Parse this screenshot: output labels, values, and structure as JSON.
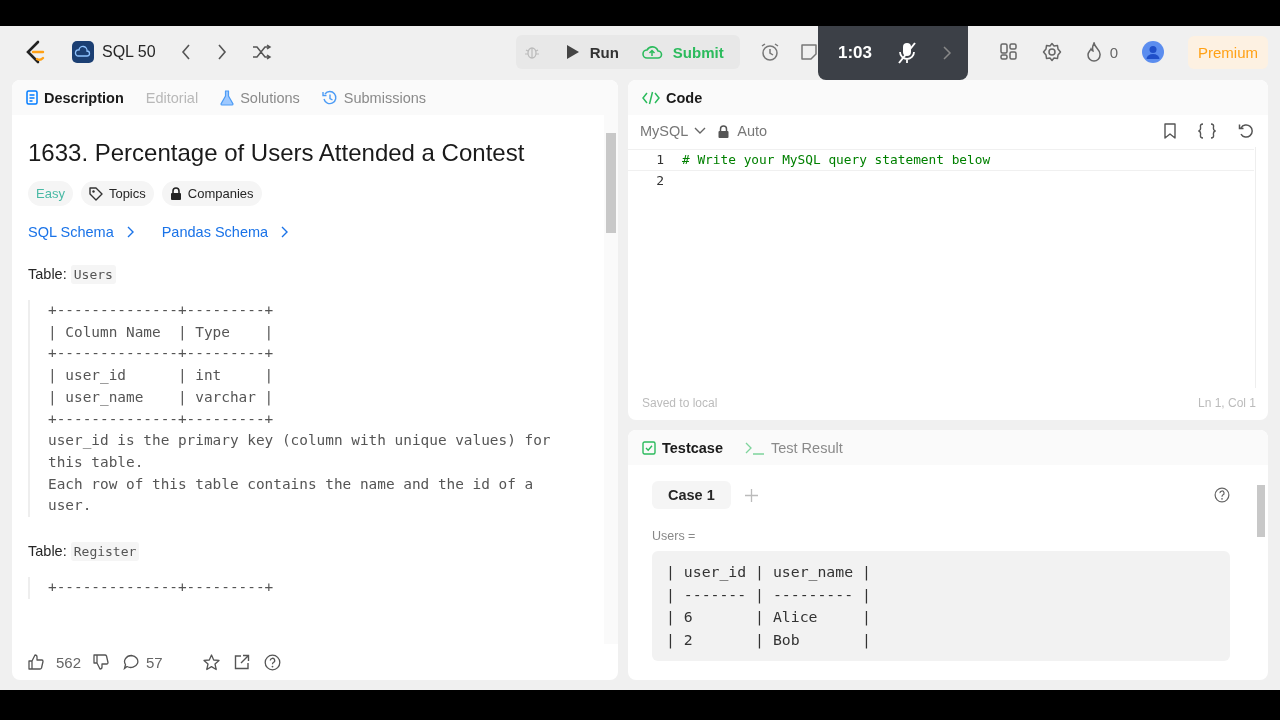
{
  "header": {
    "problem_list": "SQL 50",
    "run": "Run",
    "submit": "Submit",
    "timer": "1:03",
    "streak": "0",
    "premium": "Premium"
  },
  "description_panel": {
    "tabs": [
      {
        "label": "Description",
        "selected": true,
        "disabled": false
      },
      {
        "label": "Editorial",
        "selected": false,
        "disabled": true
      },
      {
        "label": "Solutions",
        "selected": false,
        "disabled": false
      },
      {
        "label": "Submissions",
        "selected": false,
        "disabled": false
      }
    ],
    "title": "1633. Percentage of Users Attended a Contest",
    "difficulty": "Easy",
    "tags": [
      {
        "label": "Topics"
      },
      {
        "label": "Companies"
      }
    ],
    "schema_links": [
      "SQL Schema",
      "Pandas Schema"
    ],
    "blocks": [
      {
        "kind": "table_label",
        "label": "Table:",
        "name": "Users"
      },
      {
        "kind": "code",
        "lines": [
          "+--------------+---------+",
          "| Column Name  | Type    |",
          "+--------------+---------+",
          "| user_id      | int     |",
          "| user_name    | varchar |",
          "+--------------+---------+",
          "user_id is the primary key (column with unique values) for",
          "this table.",
          "Each row of this table contains the name and the id of a",
          "user."
        ]
      },
      {
        "kind": "table_label",
        "label": "Table:",
        "name": "Register"
      },
      {
        "kind": "code",
        "lines": [
          "+--------------+---------+"
        ]
      }
    ],
    "likes": "562",
    "comments": "57"
  },
  "code_panel": {
    "tab": "Code",
    "language": "MySQL",
    "mode": "Auto",
    "lines": [
      {
        "number": "1",
        "text": "# Write your MySQL query statement below"
      },
      {
        "number": "2"
      }
    ],
    "status": "Saved to local",
    "cursor": "Ln 1, Col 1"
  },
  "test_panel": {
    "tabs": [
      {
        "label": "Testcase",
        "selected": true
      },
      {
        "label": "Test Result",
        "selected": false
      }
    ],
    "cases": [
      {
        "label": "Case 1",
        "selected": true
      }
    ],
    "input_label": "Users =",
    "table_lines": [
      "| user_id | user_name |",
      "| ------- | --------- |",
      "| 6       | Alice     |",
      "| 2       | Bob       |"
    ]
  }
}
